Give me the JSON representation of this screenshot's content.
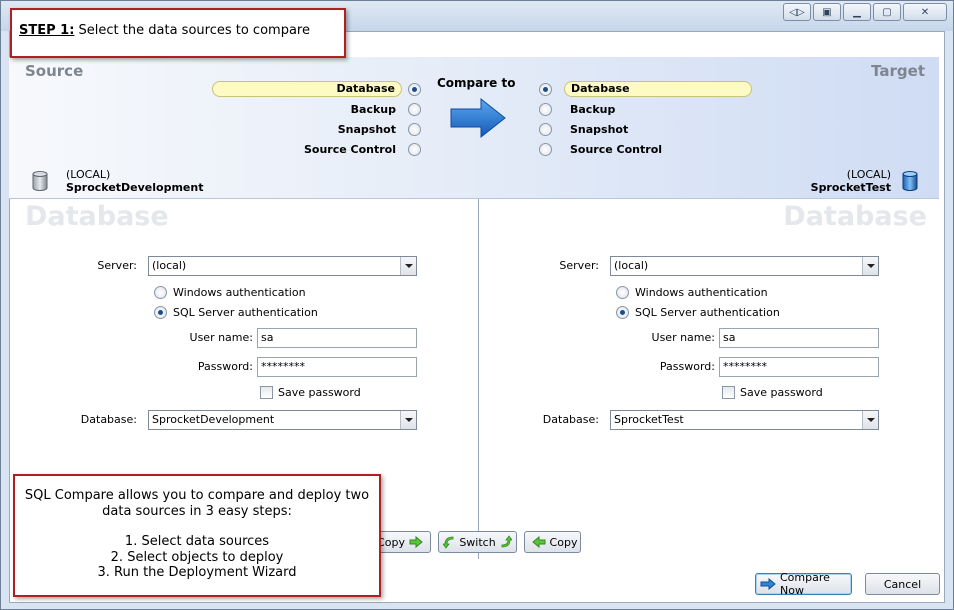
{
  "window": {
    "title_buttons": [
      "restore-layout",
      "pin",
      "minimize",
      "maximize",
      "close"
    ]
  },
  "step_callout": {
    "step_label": "STEP 1:",
    "step_text": " Select the data sources to compare"
  },
  "header": {
    "source_title": "Source",
    "target_title": "Target",
    "compare_to_label": "Compare to",
    "source_options": [
      {
        "label": "Database",
        "selected": true
      },
      {
        "label": "Backup",
        "selected": false
      },
      {
        "label": "Snapshot",
        "selected": false
      },
      {
        "label": "Source Control",
        "selected": false
      }
    ],
    "target_options": [
      {
        "label": "Database",
        "selected": true
      },
      {
        "label": "Backup",
        "selected": false
      },
      {
        "label": "Snapshot",
        "selected": false
      },
      {
        "label": "Source Control",
        "selected": false
      }
    ],
    "source_server": "(LOCAL)",
    "source_database": "SprocketDevelopment",
    "target_server": "(LOCAL)",
    "target_database": "SprocketTest"
  },
  "source_pane": {
    "watermark": "Database",
    "server_label": "Server:",
    "server_value": "(local)",
    "windows_auth_label": "Windows authentication",
    "sql_auth_label": "SQL Server authentication",
    "auth_selected": "sql",
    "username_label": "User name:",
    "username_value": "sa",
    "password_label": "Password:",
    "password_value": "********",
    "save_password_label": "Save password",
    "save_password_checked": false,
    "database_label": "Database:",
    "database_value": "SprocketDevelopment"
  },
  "target_pane": {
    "watermark": "Database",
    "server_label": "Server:",
    "server_value": "(local)",
    "windows_auth_label": "Windows authentication",
    "sql_auth_label": "SQL Server authentication",
    "auth_selected": "sql",
    "username_label": "User name:",
    "username_value": "sa",
    "password_label": "Password:",
    "password_value": "********",
    "save_password_label": "Save password",
    "save_password_checked": false,
    "database_label": "Database:",
    "database_value": "SprocketTest"
  },
  "middle_buttons": {
    "copy_right_label": "Copy",
    "switch_label": "Switch",
    "copy_left_label": "Copy"
  },
  "info_callout": {
    "line1": "SQL Compare allows you to compare and deploy two",
    "line2": "data sources in 3 easy steps:",
    "step1": "1. Select data sources",
    "step2": "2. Select objects to deploy",
    "step3": "3. Run the Deployment Wizard"
  },
  "footer": {
    "compare_now_label": "Compare Now",
    "cancel_label": "Cancel"
  },
  "colors": {
    "callout_border": "#b02020",
    "selected_option_bg": "#fdfac4",
    "arrow_blue": "#1e72c8"
  }
}
